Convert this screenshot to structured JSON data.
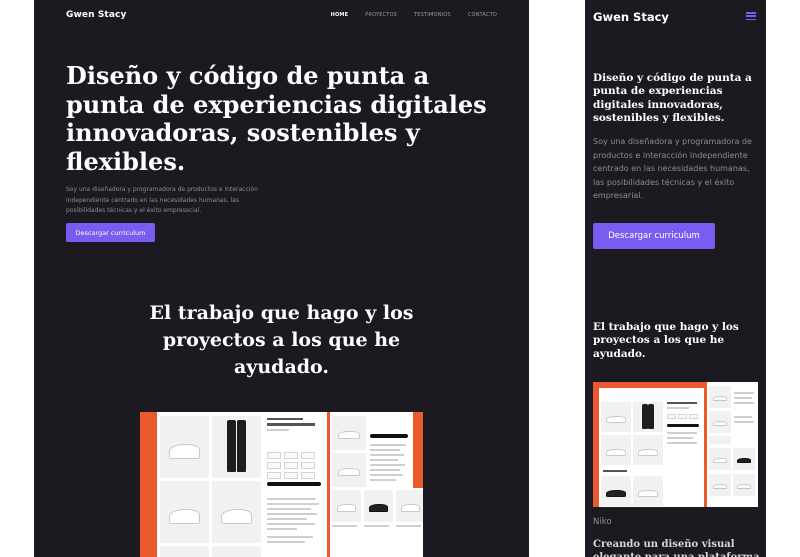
{
  "desktop": {
    "brand": "Gwen Stacy",
    "nav": [
      "HOME",
      "PROYECTOS",
      "TESTIMONIOS",
      "CONTACTO"
    ],
    "hero_title": "Diseño y código de punta a punta de experiencias digitales innovadoras, sostenibles y flexibles.",
    "hero_desc": "Soy una diseñadora y programadora de productos e interacción independiente centrado en las necesidades humanas, las posibilidades técnicas y el éxito empresscial.",
    "cta": "Descargar curriculum",
    "work_title": "El trabajo que hago y los proyectos a los que he ayudado."
  },
  "mobile": {
    "brand": "Gwen Stacy",
    "hero_title": "Diseño y código de punta a punta de experiencias digitales innovadoras, sostenibles y flexibles.",
    "hero_desc": "Soy una diseñadora y programadora de productos e interacción independiente centrado en las necesidades humanas, las posibilidades técnicas y el éxito empresarial.",
    "cta": "Descargar curriculum",
    "work_title": "El trabajo que hago y los proyectos a los que he ayudado.",
    "project_name": "Niko",
    "project_title": "Creando un diseño visual elegante para una plataforma"
  },
  "colors": {
    "background": "#1c1a20",
    "accent": "#7b5cf0",
    "showcase": "#ea5a2c",
    "text_muted": "#8e8a95"
  },
  "icons": {
    "menu": "hamburger-menu-icon"
  }
}
